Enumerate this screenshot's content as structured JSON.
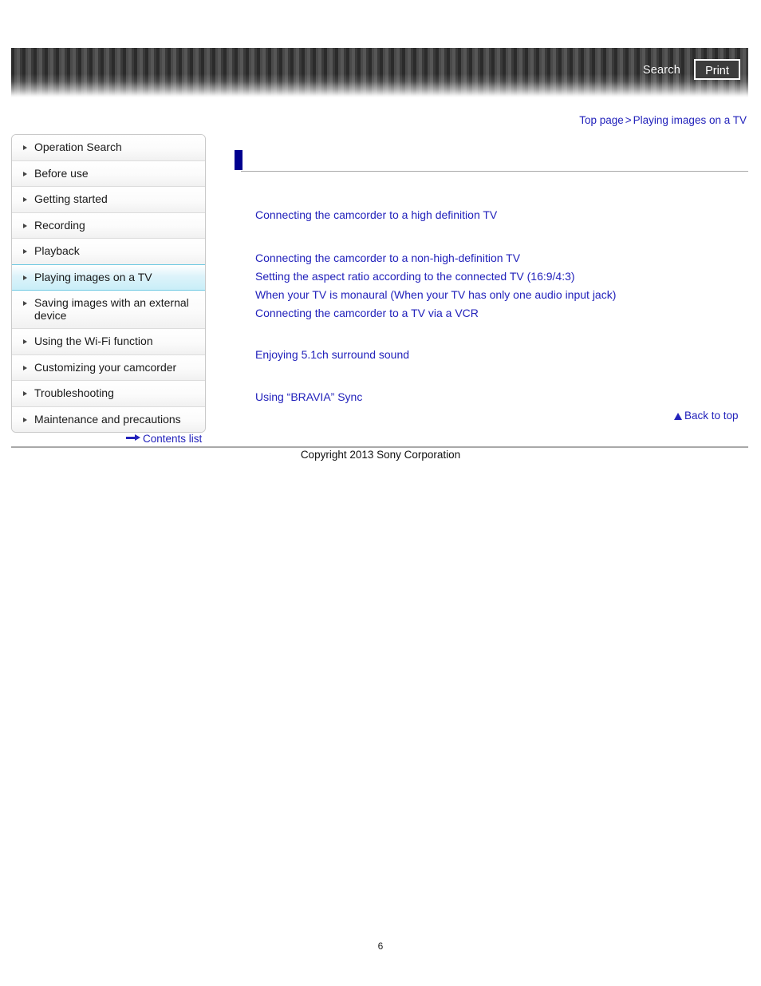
{
  "header": {
    "search_label": "Search",
    "print_label": "Print"
  },
  "breadcrumb": {
    "top_page": "Top page",
    "separator": ">",
    "current": "Playing images on a TV"
  },
  "sidebar": {
    "items": [
      {
        "label": "Operation Search",
        "active": false
      },
      {
        "label": "Before use",
        "active": false
      },
      {
        "label": "Getting started",
        "active": false
      },
      {
        "label": "Recording",
        "active": false
      },
      {
        "label": "Playback",
        "active": false
      },
      {
        "label": "Playing images on a TV",
        "active": true
      },
      {
        "label": "Saving images with an external device",
        "active": false
      },
      {
        "label": "Using the Wi-Fi function",
        "active": false
      },
      {
        "label": "Customizing your camcorder",
        "active": false
      },
      {
        "label": "Troubleshooting",
        "active": false
      },
      {
        "label": "Maintenance and precautions",
        "active": false
      }
    ],
    "contents_list_label": "Contents list"
  },
  "main": {
    "page_title": "",
    "link_group_1": [
      "Connecting the camcorder to a high definition TV"
    ],
    "link_group_2": [
      "Connecting the camcorder to a non-high-definition TV",
      "Setting the aspect ratio according to the connected TV (16:9/4:3)",
      "When your TV is monaural (When your TV has only one audio input jack)",
      "Connecting the camcorder to a TV via a VCR"
    ],
    "link_group_3": [
      "Enjoying 5.1ch surround sound"
    ],
    "link_group_4": [
      "Using “BRAVIA” Sync"
    ],
    "back_to_top_label": "Back to top"
  },
  "footer": {
    "copyright": "Copyright 2013 Sony Corporation",
    "page_number": "6"
  },
  "colors": {
    "link": "#2222bb",
    "title_marker": "#00008f",
    "active_nav": "#c9eef8"
  }
}
